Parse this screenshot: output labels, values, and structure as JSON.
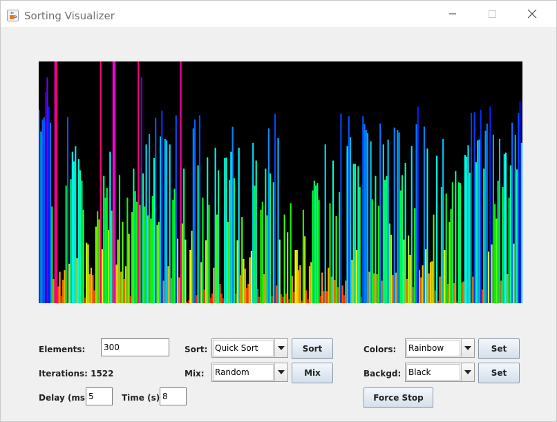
{
  "window": {
    "title": "Sorting Visualizer",
    "icon": "java-coffee-cup-icon",
    "controls": [
      "minimize-icon",
      "maximize-icon",
      "close-icon"
    ]
  },
  "visualizer": {
    "background": "#000000",
    "color_scheme": "rainbow",
    "bar_count": 300,
    "max_value": 300,
    "values": [
      240,
      213,
      228,
      231,
      262,
      280,
      244,
      224,
      120,
      30,
      325,
      349,
      21,
      39,
      9,
      29,
      41,
      146,
      231,
      49,
      154,
      188,
      176,
      195,
      56,
      179,
      165,
      152,
      116,
      7,
      75,
      73,
      36,
      44,
      35,
      16,
      95,
      114,
      104,
      347,
      67,
      158,
      131,
      143,
      91,
      188,
      115,
      321,
      327,
      48,
      79,
      159,
      39,
      101,
      30,
      46,
      131,
      86,
      9,
      113,
      167,
      139,
      126,
      346,
      122,
      280,
      161,
      120,
      197,
      109,
      210,
      105,
      133,
      180,
      230,
      97,
      101,
      207,
      239,
      28,
      204,
      202,
      46,
      197,
      31,
      128,
      142,
      233,
      80,
      32,
      338,
      99,
      167,
      79,
      2,
      4,
      66,
      90,
      217,
      228,
      10,
      171,
      233,
      51,
      131,
      17,
      78,
      181,
      122,
      7,
      12,
      44,
      193,
      110,
      165,
      24,
      12,
      6,
      180,
      181,
      101,
      153,
      188,
      219,
      155,
      12,
      78,
      193,
      35,
      107,
      55,
      43,
      19,
      24,
      57,
      65,
      199,
      146,
      177,
      18,
      8,
      116,
      126,
      36,
      167,
      109,
      217,
      161,
      9,
      150,
      235,
      22,
      205,
      79,
      11,
      8,
      110,
      12,
      88,
      5,
      124,
      34,
      14,
      66,
      66,
      41,
      47,
      3,
      116,
      83,
      16,
      5,
      46,
      51,
      140,
      152,
      146,
      149,
      128,
      9,
      38,
      15,
      197,
      15,
      44,
      124,
      33,
      177,
      29,
      108,
      20,
      138,
      235,
      22,
      10,
      28,
      195,
      232,
      206,
      54,
      173,
      173,
      66,
      170,
      144,
      8,
      232,
      222,
      215,
      211,
      39,
      201,
      129,
      37,
      158,
      36,
      121,
      223,
      28,
      197,
      153,
      158,
      203,
      99,
      85,
      35,
      218,
      38,
      215,
      212,
      140,
      159,
      79,
      174,
      30,
      84,
      60,
      195,
      20,
      118,
      222,
      244,
      41,
      32,
      47,
      219,
      67,
      192,
      37,
      51,
      52,
      110,
      16,
      183,
      3,
      33,
      144,
      204,
      66,
      136,
      24,
      101,
      117,
      150,
      25,
      164,
      3,
      150,
      149,
      26,
      27,
      184,
      182,
      196,
      162,
      236,
      33,
      237,
      175,
      202,
      203,
      240,
      17,
      167,
      214,
      223,
      64,
      244,
      73,
      209,
      123,
      105,
      152,
      204,
      28,
      144,
      185,
      187,
      36,
      131,
      171,
      224,
      74,
      209,
      166,
      236,
      251,
      199
    ]
  },
  "controls": {
    "elements_label": "Elements:",
    "elements_value": "300",
    "iterations_label": "Iterations: 1522",
    "delay_label": "Delay (ms):",
    "delay_value": "5",
    "time_label": "Time (s):",
    "time_value": "8",
    "sort_label": "Sort:",
    "sort_selected": "Quick Sort",
    "sort_button": "Sort",
    "mix_label": "Mix:",
    "mix_selected": "Random",
    "mix_button": "Mix",
    "colors_label": "Colors:",
    "colors_selected": "Rainbow",
    "colors_set_button": "Set",
    "backgd_label": "Backgd:",
    "backgd_selected": "Black",
    "backgd_set_button": "Set",
    "force_stop_button": "Force Stop"
  }
}
